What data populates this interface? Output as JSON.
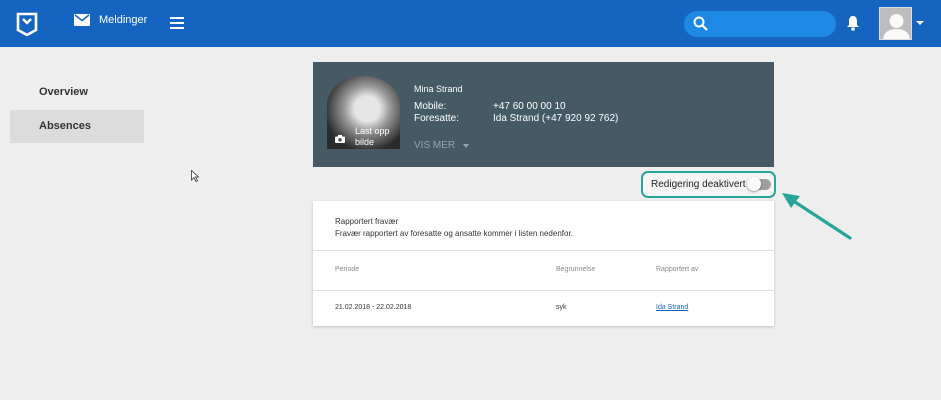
{
  "header": {
    "messages_label": "Meldinger",
    "search_placeholder": "",
    "brand_color": "#1565c0"
  },
  "sidebar": {
    "items": [
      {
        "label": "Overview",
        "active": false
      },
      {
        "label": "Absences",
        "active": true
      }
    ]
  },
  "profile": {
    "name": "Mina Strand",
    "upload_label": "Last opp bilde",
    "mobile_label": "Mobile:",
    "mobile_value": "+47 60 00 00 10",
    "guardian_label": "Foresatte:",
    "guardian_value": "Ida Strand (+47 920 92 762)",
    "show_more": "VIS MER"
  },
  "editing": {
    "label": "Redigering deaktivert",
    "enabled": false,
    "highlight_color": "#26a69a"
  },
  "absences": {
    "title": "Rapportert fravær",
    "description": "Fravær rapportert av foresatte og ansatte kommer i listen nedenfor.",
    "columns": [
      "Periode",
      "Begrunnelse",
      "Rapportert av"
    ],
    "rows": [
      {
        "period": "21.02.2018 - 22.02.2018",
        "reason": "syk",
        "reported_by": "Ida Strand"
      }
    ]
  }
}
